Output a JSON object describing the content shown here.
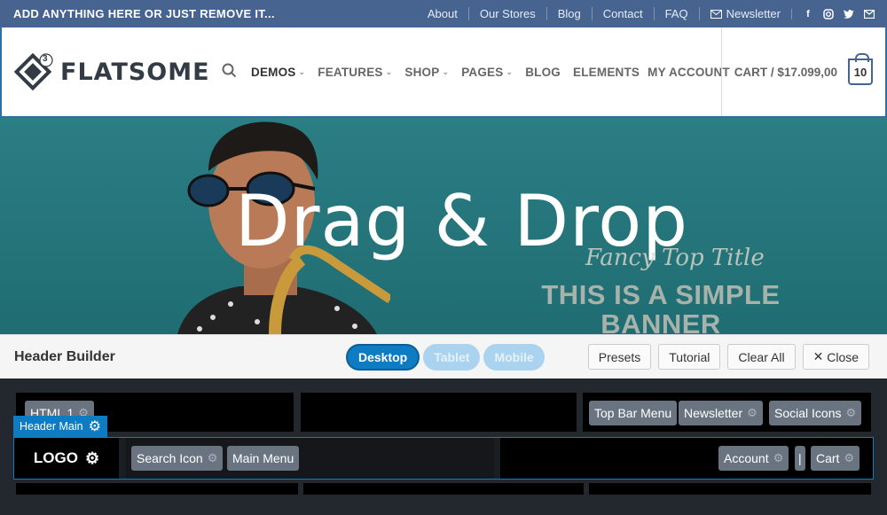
{
  "topbar": {
    "text": "ADD ANYTHING HERE OR JUST REMOVE IT...",
    "links": [
      "About",
      "Our Stores",
      "Blog",
      "Contact",
      "FAQ"
    ],
    "newsletter": "Newsletter"
  },
  "header": {
    "logo_text": "FLATSOME",
    "logo_badge": "3",
    "nav": [
      "DEMOS",
      "FEATURES",
      "SHOP",
      "PAGES",
      "BLOG",
      "ELEMENTS",
      "MY ACCOUNT"
    ],
    "cart_text": "CART / $17.099,00",
    "cart_count": "10"
  },
  "banner": {
    "headline": "Drag & Drop",
    "fancy": "Fancy Top Title",
    "simple_line1": "THIS IS A SIMPLE",
    "simple_line2": "BANNER"
  },
  "builder_bar": {
    "title": "Header Builder",
    "devices": [
      "Desktop",
      "Tablet",
      "Mobile"
    ],
    "actions": [
      "Presets",
      "Tutorial",
      "Clear All",
      "Close"
    ]
  },
  "builder": {
    "top_left_chip": "HTML 1",
    "top_right_chips": [
      "Top Bar Menu",
      "Newsletter",
      "Social Icons"
    ],
    "main_tag": "Header Main",
    "logo": "LOGO",
    "main_left_chips": [
      "Search Icon",
      "Main Menu"
    ],
    "main_right_chips": [
      "Account",
      "|",
      "Cart"
    ]
  },
  "colors": {
    "topbar": "#476491",
    "accent": "#0e7cc2",
    "builder_bg": "#23272e"
  }
}
